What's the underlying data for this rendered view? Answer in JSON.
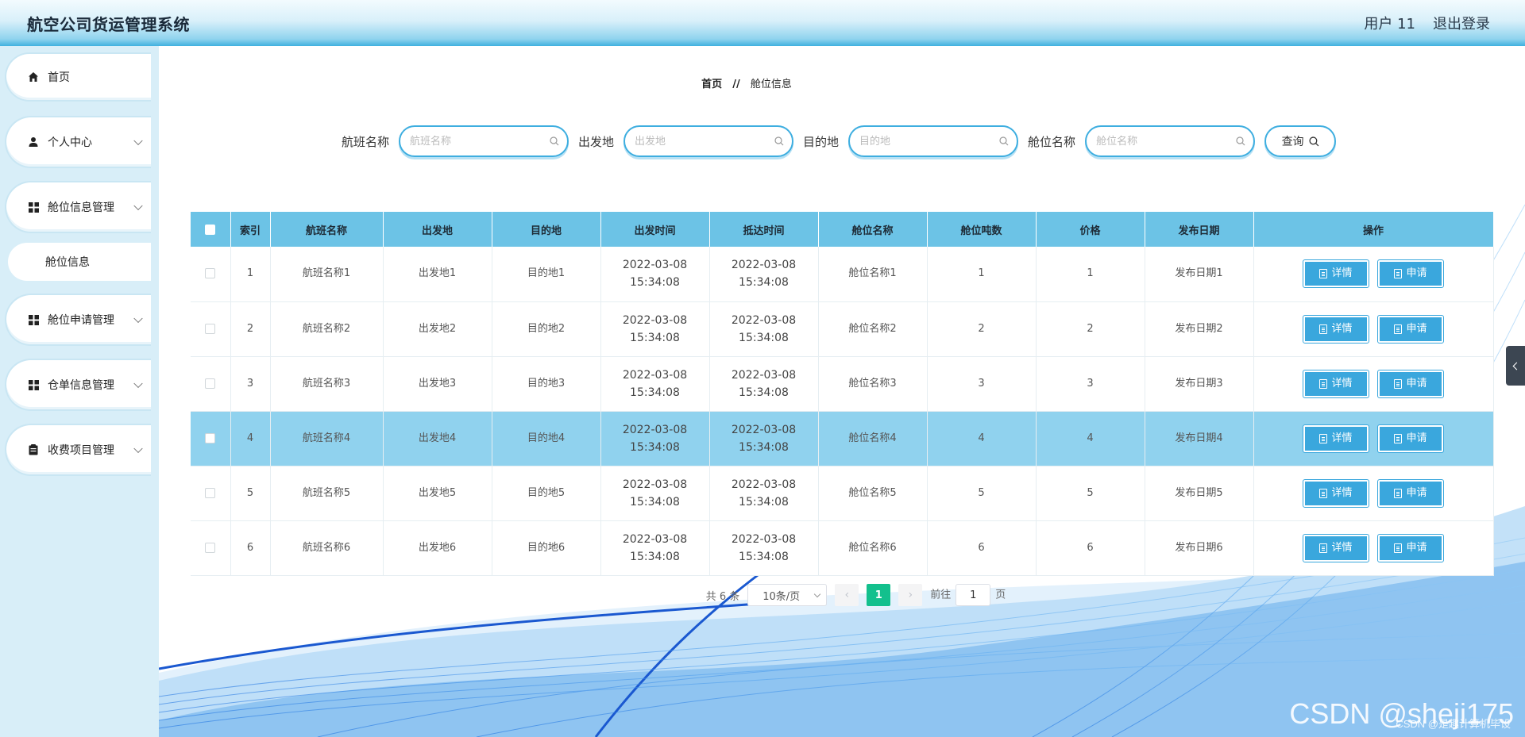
{
  "header": {
    "title": "航空公司货运管理系统",
    "user": "用户 11",
    "logout": "退出登录"
  },
  "sidebar": {
    "items": [
      {
        "label": "首页"
      },
      {
        "label": "个人中心"
      },
      {
        "label": "舱位信息管理"
      },
      {
        "label": "舱位申请管理"
      },
      {
        "label": "仓单信息管理"
      },
      {
        "label": "收费项目管理"
      }
    ],
    "sub_item": "舱位信息"
  },
  "breadcrumb": {
    "home": "首页",
    "sep": "//",
    "current": "舱位信息"
  },
  "search": {
    "flight_label": "航班名称",
    "flight_placeholder": "航班名称",
    "from_label": "出发地",
    "from_placeholder": "出发地",
    "to_label": "目的地",
    "to_placeholder": "目的地",
    "cabin_label": "舱位名称",
    "cabin_placeholder": "舱位名称",
    "query_label": "查询"
  },
  "table": {
    "headers": [
      "索引",
      "航班名称",
      "出发地",
      "目的地",
      "出发时间",
      "抵达时间",
      "舱位名称",
      "舱位吨数",
      "价格",
      "发布日期",
      "操作"
    ],
    "rows": [
      [
        "1",
        "航班名称1",
        "出发地1",
        "目的地1",
        "2022-03-08 15:34:08",
        "2022-03-08 15:34:08",
        "舱位名称1",
        "1",
        "1",
        "发布日期1"
      ],
      [
        "2",
        "航班名称2",
        "出发地2",
        "目的地2",
        "2022-03-08 15:34:08",
        "2022-03-08 15:34:08",
        "舱位名称2",
        "2",
        "2",
        "发布日期2"
      ],
      [
        "3",
        "航班名称3",
        "出发地3",
        "目的地3",
        "2022-03-08 15:34:08",
        "2022-03-08 15:34:08",
        "舱位名称3",
        "3",
        "3",
        "发布日期3"
      ],
      [
        "4",
        "航班名称4",
        "出发地4",
        "目的地4",
        "2022-03-08 15:34:08",
        "2022-03-08 15:34:08",
        "舱位名称4",
        "4",
        "4",
        "发布日期4"
      ],
      [
        "5",
        "航班名称5",
        "出发地5",
        "目的地5",
        "2022-03-08 15:34:08",
        "2022-03-08 15:34:08",
        "舱位名称5",
        "5",
        "5",
        "发布日期5"
      ],
      [
        "6",
        "航班名称6",
        "出发地6",
        "目的地6",
        "2022-03-08 15:34:08",
        "2022-03-08 15:34:08",
        "舱位名称6",
        "6",
        "6",
        "发布日期6"
      ]
    ],
    "detail_label": "详情",
    "apply_label": "申请"
  },
  "pagination": {
    "total": "共 6 条",
    "page_size": "10条/页",
    "current_page": "1",
    "goto_label": "前往",
    "goto_value": "1",
    "page_unit": "页"
  },
  "watermark": {
    "big": "CSDN @sheji175",
    "small": "CSDN @是趣计算机毕设"
  },
  "colors": {
    "accent": "#3aa7dd",
    "header_bg": "#6cc3e6",
    "highlight_row": "#90d2ee",
    "page_active": "#13c08d"
  }
}
